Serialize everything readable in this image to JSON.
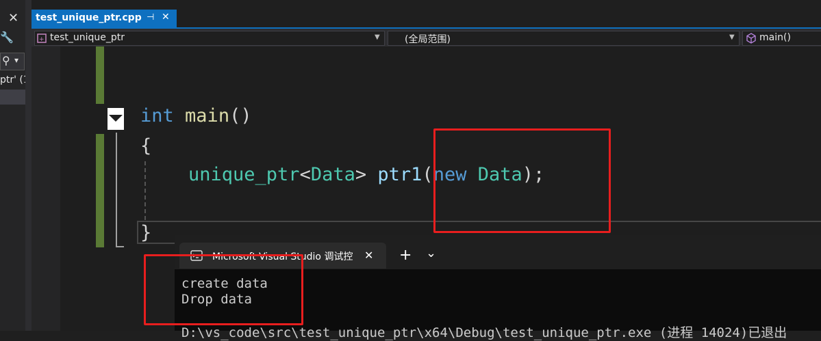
{
  "left_panel": {
    "close_glyph": "✕",
    "wrench_glyph": "🔧",
    "search_glyph": "⚲",
    "dropdown_glyph": "▾",
    "item_label": "ptr' (1"
  },
  "tab": {
    "title": "test_unique_ptr.cpp",
    "pin_glyph": "⊣",
    "close_glyph": "✕"
  },
  "navbar": {
    "project": "test_unique_ptr",
    "scope": "(全局范围)",
    "member": "main()"
  },
  "code": {
    "line1_keyword": "int",
    "line1_func": "main",
    "line1_parens": "()",
    "open_brace": "{",
    "line3_type": "unique_ptr",
    "line3_lt": "<",
    "line3_targ": "Data",
    "line3_gt": ">",
    "line3_var": "ptr1",
    "line3_open": "(",
    "line3_new": "new",
    "line3_data": "Data",
    "line3_close": ");",
    "close_brace": "}"
  },
  "console": {
    "tab_title": "Microsoft Visual Studio 调试控",
    "tab_close": "✕",
    "new_tab": "+",
    "dropdown": "⌄",
    "output_lines": [
      "create data",
      "Drop data"
    ],
    "status_line": "D:\\vs_code\\src\\test_unique_ptr\\x64\\Debug\\test_unique_ptr.exe (进程 14024)已退出"
  },
  "colors": {
    "accent": "#0e70c0",
    "highlight": "#e81e1e",
    "change_bar": "#5a7a35"
  }
}
